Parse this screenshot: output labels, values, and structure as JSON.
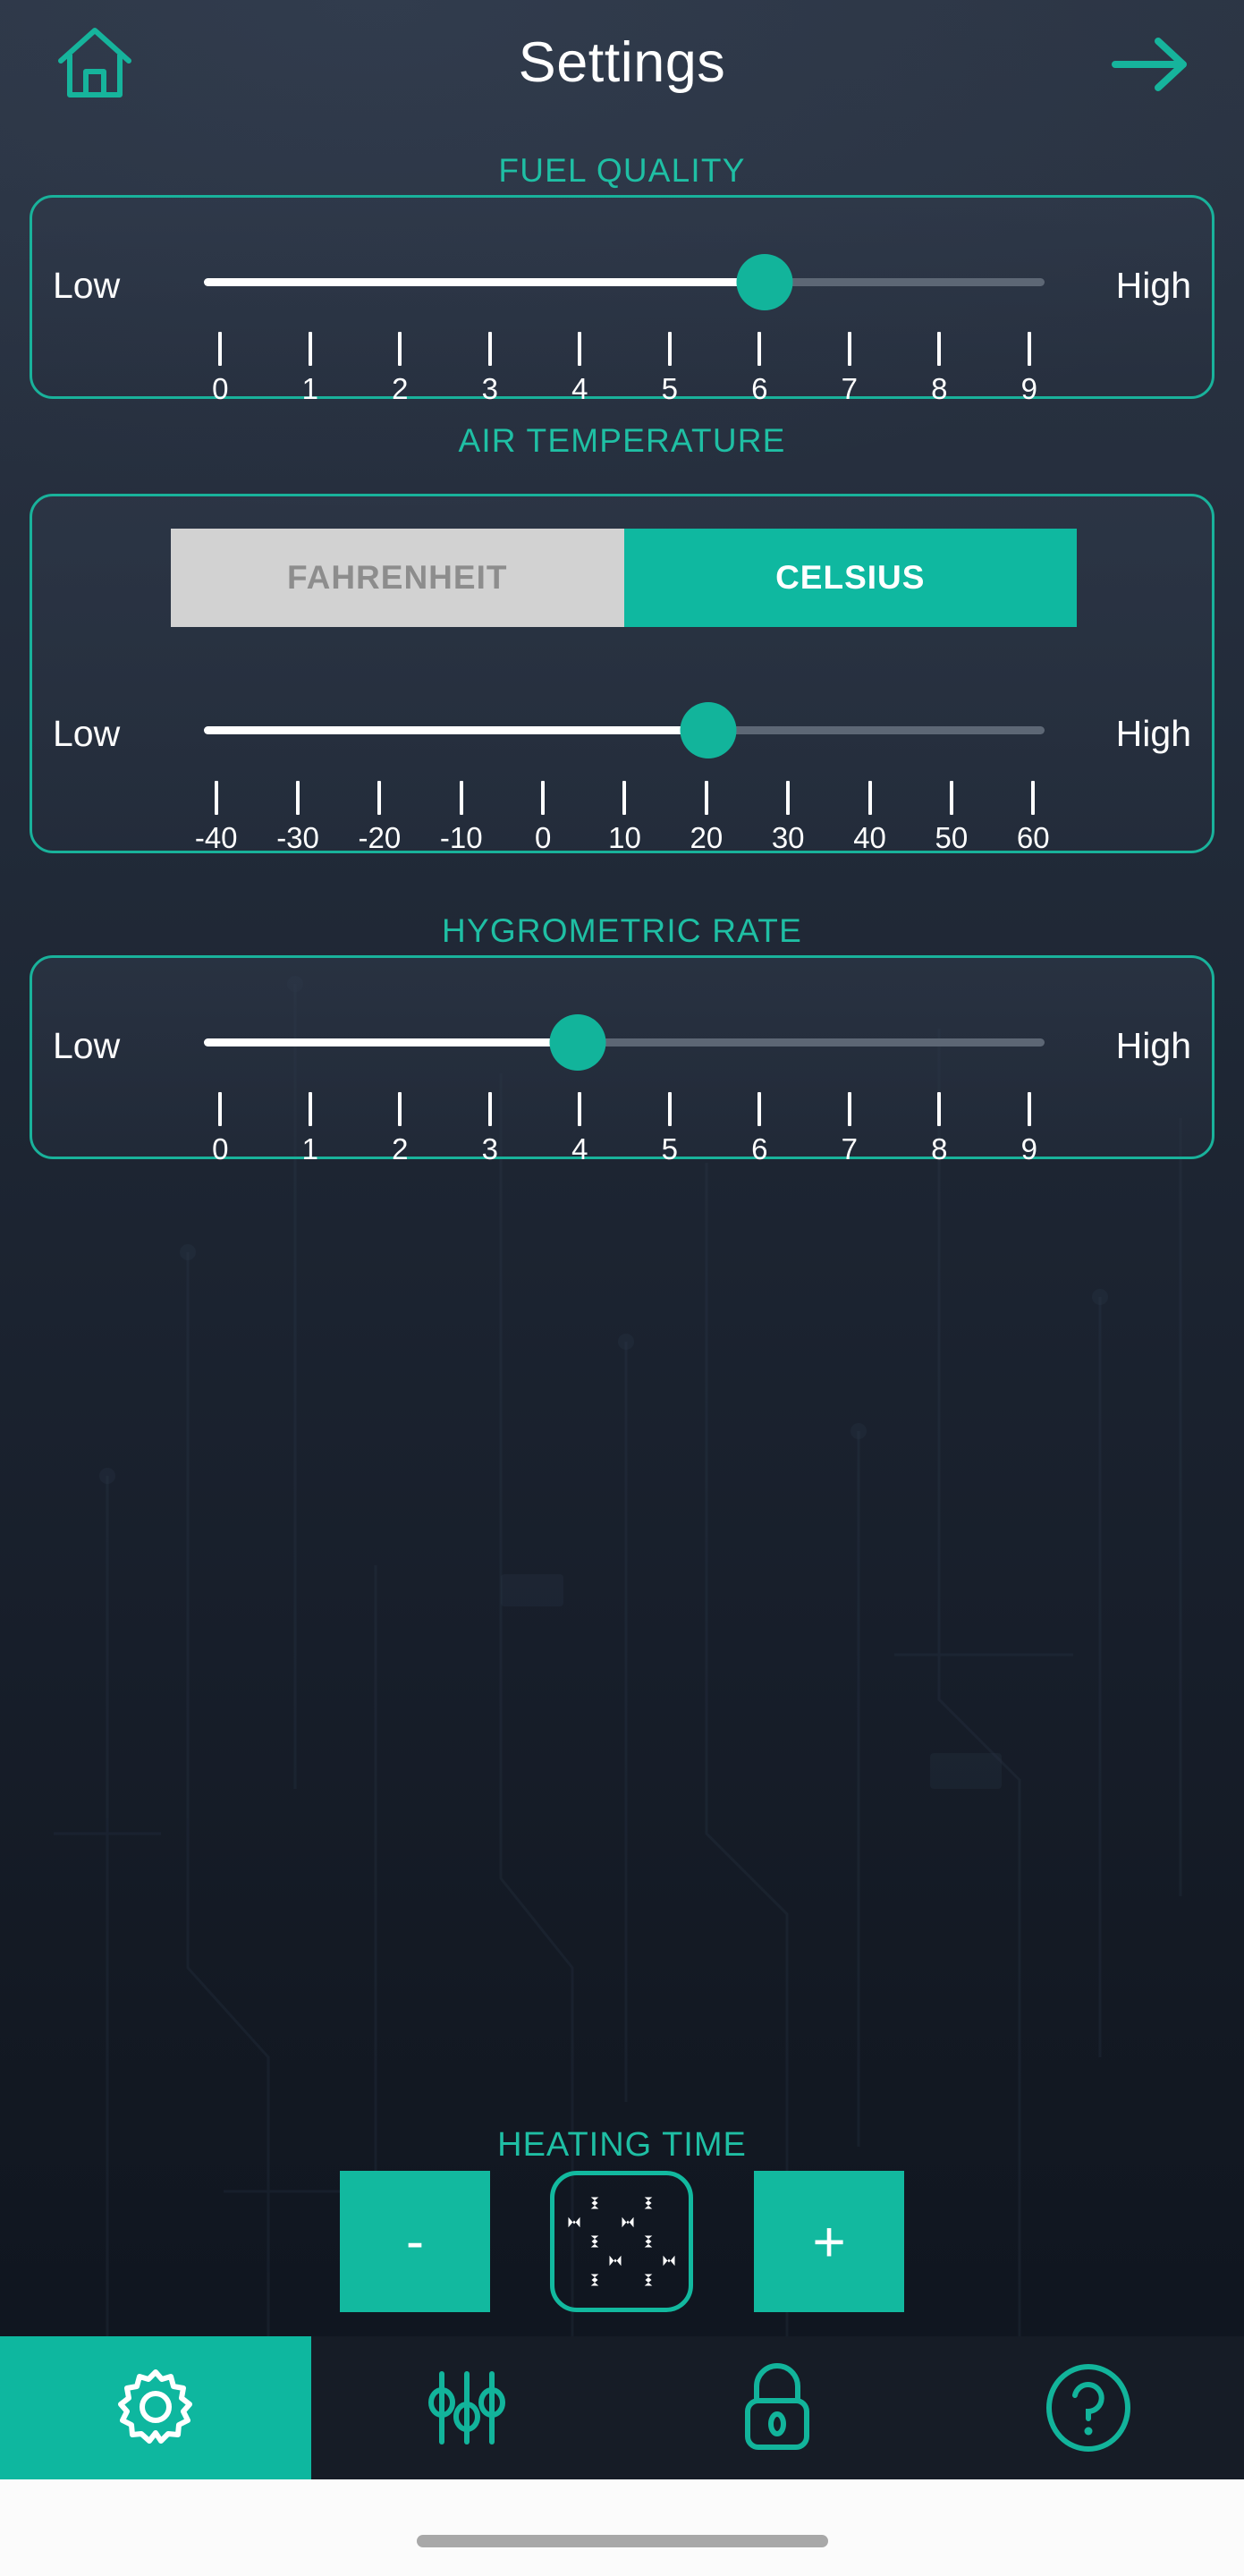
{
  "header": {
    "title": "Settings",
    "home_icon": "home-icon",
    "forward_icon": "arrow-right-icon"
  },
  "sections": {
    "fuel_quality": {
      "label": "FUEL QUALITY",
      "low_label": "Low",
      "high_label": "High",
      "value": 6,
      "min": 0,
      "max": 9,
      "ticks": [
        "0",
        "1",
        "2",
        "3",
        "4",
        "5",
        "6",
        "7",
        "8",
        "9"
      ]
    },
    "air_temperature": {
      "label": "AIR TEMPERATURE",
      "unit_options": [
        "FAHRENHEIT",
        "CELSIUS"
      ],
      "unit_selected": "CELSIUS",
      "low_label": "Low",
      "high_label": "High",
      "value": 20,
      "min": -40,
      "max": 60,
      "ticks": [
        "-40",
        "-30",
        "-20",
        "-10",
        "0",
        "10",
        "20",
        "30",
        "40",
        "50",
        "60"
      ]
    },
    "hygrometric_rate": {
      "label": "HYGROMETRIC RATE",
      "low_label": "Low",
      "high_label": "High",
      "value": 4,
      "min": 0,
      "max": 9,
      "ticks": [
        "0",
        "1",
        "2",
        "3",
        "4",
        "5",
        "6",
        "7",
        "8",
        "9"
      ]
    }
  },
  "heating_time": {
    "label": "HEATING TIME",
    "decrement_label": "-",
    "increment_label": "+",
    "value": "55"
  },
  "navbar": {
    "items": [
      {
        "icon": "gear-icon",
        "active": true
      },
      {
        "icon": "sliders-icon",
        "active": false
      },
      {
        "icon": "lock-icon",
        "active": false
      },
      {
        "icon": "help-circle-icon",
        "active": false
      }
    ]
  },
  "colors": {
    "accent": "#12b49b",
    "accent_border": "#19b29b",
    "label_teal": "#1fbfa4",
    "background_top": "#2b3443",
    "background_bottom": "#0e131c",
    "track_inactive": "#5d6775",
    "track_active": "#ffffff",
    "toggle_inactive_bg": "#d2d2d2",
    "toggle_inactive_text": "#8d8d8d",
    "navbar_bg": "#161c26"
  }
}
